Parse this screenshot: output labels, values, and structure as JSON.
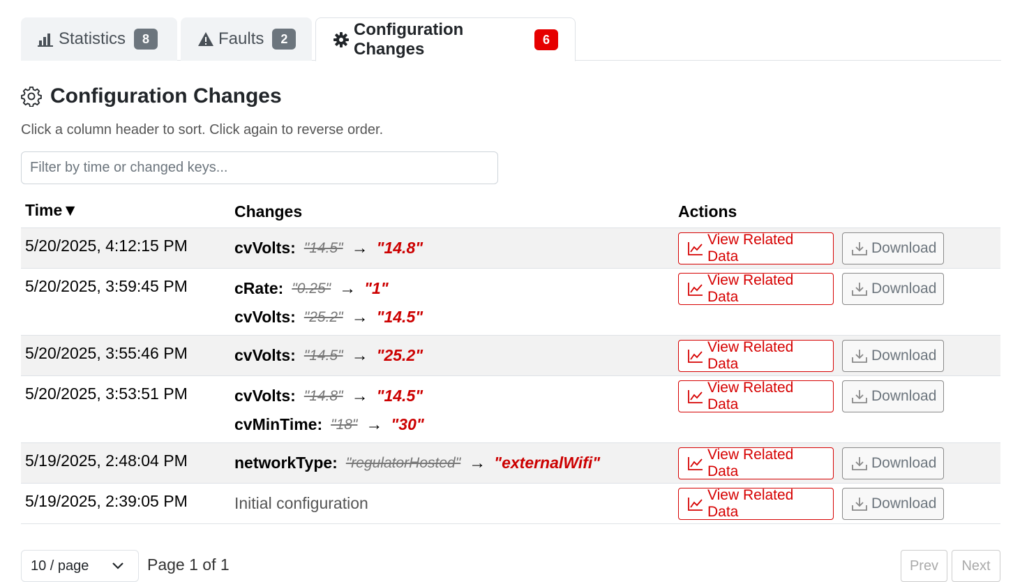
{
  "tabs": [
    {
      "label": "Statistics",
      "badge": "8",
      "icon": "bar-chart-icon"
    },
    {
      "label": "Faults",
      "badge": "2",
      "icon": "warning-icon"
    },
    {
      "label": "Configuration Changes",
      "badge": "6",
      "icon": "gear-icon",
      "active": true
    }
  ],
  "section": {
    "title": "Configuration Changes",
    "hint": "Click a column header to sort. Click again to reverse order.",
    "filter_placeholder": "Filter by time or changed keys..."
  },
  "table": {
    "headers": {
      "time": "Time",
      "sort_indicator": "▼",
      "changes": "Changes",
      "actions": "Actions"
    },
    "buttons": {
      "view": "View Related Data",
      "download": "Download"
    },
    "rows": [
      {
        "time": "5/20/2025, 4:12:15 PM",
        "changes": [
          {
            "key": "cvVolts:",
            "old": "\"14.5\"",
            "arrow": "→",
            "new": "\"14.8\""
          }
        ]
      },
      {
        "time": "5/20/2025, 3:59:45 PM",
        "changes": [
          {
            "key": "cRate:",
            "old": "\"0.25\"",
            "arrow": "→",
            "new": "\"1\""
          },
          {
            "key": "cvVolts:",
            "old": "\"25.2\"",
            "arrow": "→",
            "new": "\"14.5\""
          }
        ]
      },
      {
        "time": "5/20/2025, 3:55:46 PM",
        "changes": [
          {
            "key": "cvVolts:",
            "old": "\"14.5\"",
            "arrow": "→",
            "new": "\"25.2\""
          }
        ]
      },
      {
        "time": "5/20/2025, 3:53:51 PM",
        "changes": [
          {
            "key": "cvVolts:",
            "old": "\"14.8\"",
            "arrow": "→",
            "new": "\"14.5\""
          },
          {
            "key": "cvMinTime:",
            "old": "\"18\"",
            "arrow": "→",
            "new": "\"30\""
          }
        ]
      },
      {
        "time": "5/19/2025, 2:48:04 PM",
        "changes": [
          {
            "key": "networkType:",
            "old": "\"regulatorHosted\"",
            "arrow": "→",
            "new": "\"externalWifi\""
          }
        ]
      },
      {
        "time": "5/19/2025, 2:39:05 PM",
        "initial": "Initial configuration"
      }
    ]
  },
  "pagination": {
    "page_size": "10 / page",
    "page_info": "Page 1 of 1",
    "prev": "Prev",
    "next": "Next"
  },
  "colors": {
    "accent_red": "#d60000",
    "badge_gray": "#6c757d",
    "badge_red": "#e60000",
    "row_alt": "#f2f2f2"
  }
}
